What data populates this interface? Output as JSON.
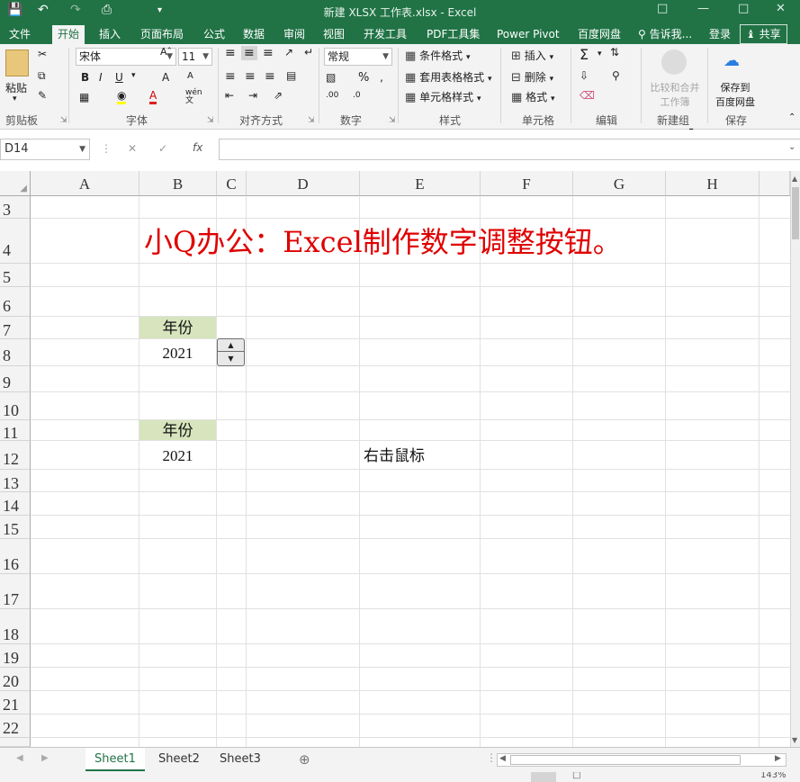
{
  "window": {
    "title": "新建 XLSX 工作表.xlsx - Excel",
    "quick_access": [
      "save-icon",
      "undo-icon",
      "redo-icon",
      "print-preview-icon"
    ]
  },
  "tabs": [
    {
      "label": "文件"
    },
    {
      "label": "开始",
      "active": true
    },
    {
      "label": "插入"
    },
    {
      "label": "页面布局"
    },
    {
      "label": "公式"
    },
    {
      "label": "数据"
    },
    {
      "label": "审阅"
    },
    {
      "label": "视图"
    },
    {
      "label": "开发工具"
    },
    {
      "label": "PDF工具集"
    },
    {
      "label": "Power Pivot"
    },
    {
      "label": "百度网盘"
    }
  ],
  "tell_me": "告诉我...",
  "login": "登录",
  "share": "共享",
  "ribbon": {
    "clipboard": {
      "paste": "粘贴",
      "label": "剪贴板"
    },
    "font": {
      "name": "宋体",
      "size": "11",
      "bold": "B",
      "italic": "I",
      "underline": "U",
      "label": "字体",
      "wen": "wén\n文"
    },
    "alignment": {
      "label": "对齐方式"
    },
    "number": {
      "format": "常规",
      "label": "数字"
    },
    "styles": {
      "conditional": "条件格式",
      "table": "套用表格格式",
      "cell": "单元格样式",
      "label": "样式"
    },
    "cells": {
      "insert": "插入",
      "delete": "删除",
      "format": "格式",
      "label": "单元格"
    },
    "editing": {
      "label": "编辑"
    },
    "newgroup": {
      "compare_line1": "比较和合并",
      "compare_line2": "工作簿",
      "label": "新建组"
    },
    "save": {
      "line1": "保存到",
      "line2": "百度网盘",
      "label": "保存"
    }
  },
  "formula_bar": {
    "name_box": "D14",
    "fx": "fx",
    "formula": ""
  },
  "columns": [
    "A",
    "B",
    "C",
    "D",
    "E",
    "F",
    "G",
    "H"
  ],
  "rows": [
    "3",
    "4",
    "5",
    "6",
    "7",
    "8",
    "9",
    "10",
    "11",
    "12",
    "13",
    "14",
    "15",
    "16",
    "17",
    "18",
    "19",
    "20",
    "21",
    "22"
  ],
  "cells": {
    "title": "小Q办公：Excel制作数字调整按钮。",
    "b7": "年份",
    "b8": "2021",
    "b11": "年份",
    "b12": "2021",
    "e12": "右击鼠标"
  },
  "sheets": [
    {
      "label": "Sheet1",
      "active": true
    },
    {
      "label": "Sheet2"
    },
    {
      "label": "Sheet3"
    }
  ],
  "status": {
    "zoom": "143%"
  }
}
